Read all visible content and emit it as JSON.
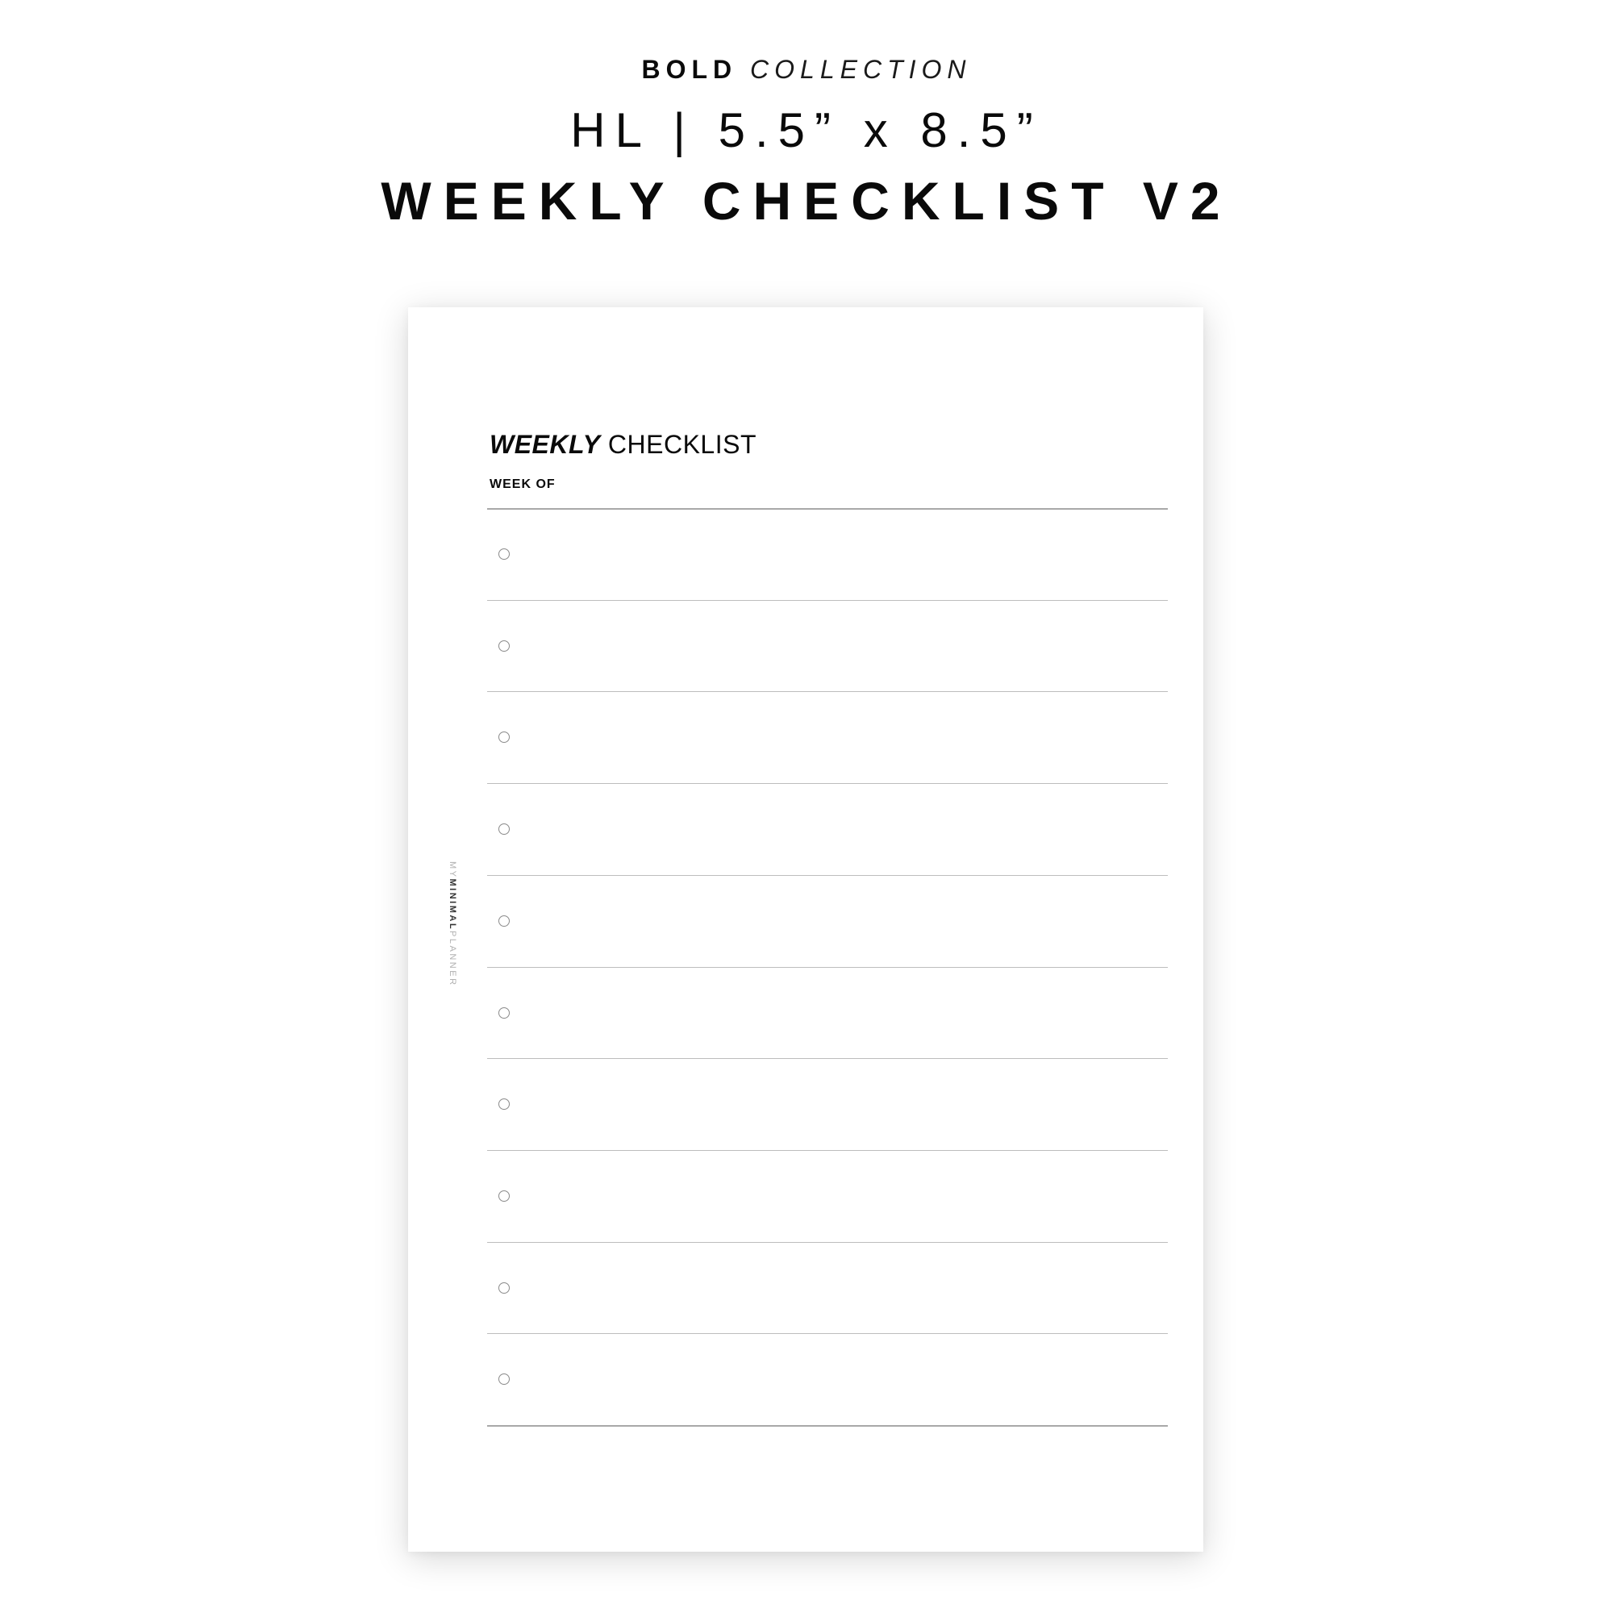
{
  "header": {
    "collection_bold": "BOLD",
    "collection_light": "COLLECTION",
    "size_line": "HL | 5.5” x 8.5”",
    "product_title": "WEEKLY CHECKLIST V2"
  },
  "page": {
    "title_italic": "WEEKLY",
    "title_regular": "CHECKLIST",
    "week_of_label": "WEEK OF",
    "checklist_item_count": 10,
    "checkbox_icon": "circle-outline",
    "brand": {
      "prefix": "MY",
      "emphasis": "MINIMAL",
      "suffix": "PLANNER"
    }
  },
  "colors": {
    "text": "#0a0a0a",
    "rule_strong": "#a8a8a8",
    "rule_light": "#bdbdbd",
    "checkbox": "#8a8a8a",
    "brand_light": "#b0b0b0"
  }
}
